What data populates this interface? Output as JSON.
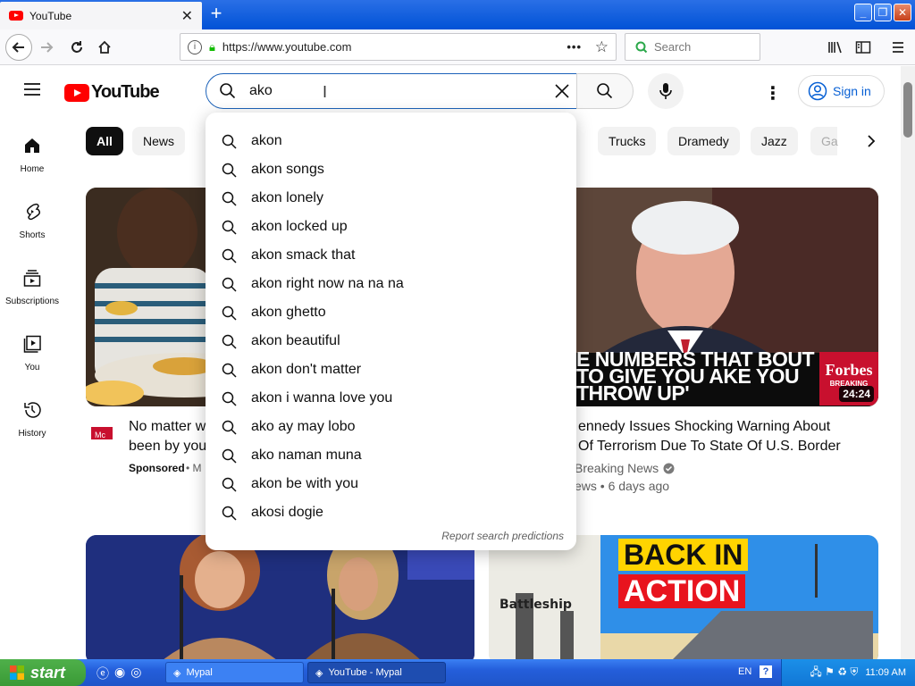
{
  "browser": {
    "tab_title": "YouTube",
    "url": "https://www.youtube.com",
    "search_placeholder": "Search"
  },
  "yt": {
    "logo_text": "YouTube",
    "search_value": "ako",
    "signin_label": "Sign in"
  },
  "chips": [
    "All",
    "News",
    "Trucks",
    "Dramedy",
    "Jazz",
    "Ga"
  ],
  "sidebar": [
    {
      "label": "Home"
    },
    {
      "label": "Shorts"
    },
    {
      "label": "Subscriptions"
    },
    {
      "label": "You"
    },
    {
      "label": "History"
    }
  ],
  "suggestions": [
    "akon",
    "akon songs",
    "akon lonely",
    "akon locked up",
    "akon smack that",
    "akon right now na na na",
    "akon ghetto",
    "akon beautiful",
    "akon don't matter",
    "akon i wanna love you",
    "ako ay may lobo",
    "ako naman muna",
    "akon be with you",
    "akosi dogie"
  ],
  "report_label": "Report search predictions",
  "videos": {
    "left": {
      "title_line1": "No matter w",
      "title_line2": "been by you",
      "sponsored": "Sponsored",
      "sponsor_tail": "M"
    },
    "right": {
      "title_line1": "ennedy Issues Shocking Warning About",
      "title_line2": "Of Terrorism Due To State Of U.S. Border",
      "channel": "Breaking News",
      "stats": "ews • 6 days ago",
      "duration": "24:24",
      "overlay_text": "E NUMBERS THAT BOUT TO GIVE YOU AKE YOU THROW UP'",
      "brand": "Forbes",
      "brand_sub": "BREAKING"
    },
    "bottom_right": {
      "overlay_line1": "BACK IN",
      "overlay_line2": "ACTION",
      "caption": "Battleship"
    }
  },
  "taskbar": {
    "start_label": "start",
    "tasks": [
      "Mypal",
      "YouTube - Mypal"
    ],
    "lang": "EN",
    "clock": "11:09 AM"
  }
}
